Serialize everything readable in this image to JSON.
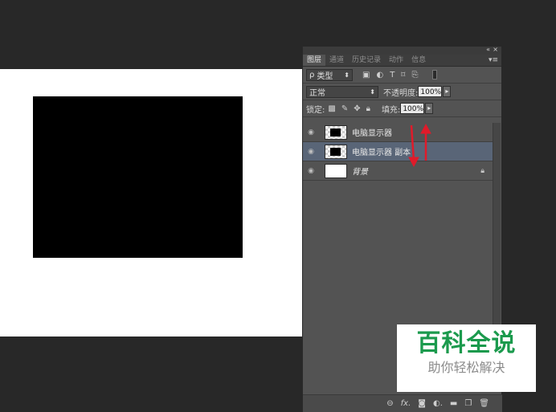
{
  "panel": {
    "collapse_icon": "«",
    "close_icon": "×",
    "tabs": [
      {
        "label": "图层"
      },
      {
        "label": "通道"
      },
      {
        "label": "历史记录"
      },
      {
        "label": "动作"
      },
      {
        "label": "信息"
      }
    ],
    "menu_icon": "▾≡"
  },
  "filter": {
    "search_glyph": "ρ",
    "kind_label": "类型",
    "icons": [
      "image-filter-icon",
      "adjustment-filter-icon",
      "type-filter-icon",
      "shape-filter-icon",
      "smart-object-filter-icon"
    ]
  },
  "blend": {
    "mode": "正常",
    "opacity_label": "不透明度:",
    "opacity_value": "100%"
  },
  "lock": {
    "label": "锁定:",
    "fill_label": "填充:",
    "fill_value": "100%"
  },
  "layers": [
    {
      "name": "电脑显示器",
      "selected": false
    },
    {
      "name": "电脑显示器 副本",
      "selected": true
    },
    {
      "name": "背景",
      "selected": false
    }
  ],
  "bottom_icons": [
    "link-icon",
    "fx-icon",
    "mask-icon",
    "adjustment-icon",
    "group-folder-icon",
    "new-layer-icon",
    "trash-icon"
  ],
  "watermark": {
    "title": "百科全说",
    "subtitle": "助你轻松解决"
  },
  "colors": {
    "watermark_green": "#1b9a4d",
    "arrow_red": "#e01b2a",
    "selected_layer": "#596577"
  }
}
